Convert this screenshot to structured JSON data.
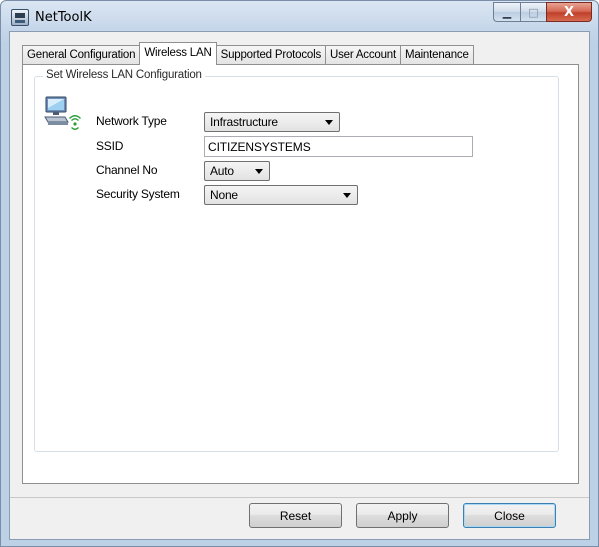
{
  "window": {
    "title": "NetToolK",
    "caption_buttons": {
      "minimize": "▁",
      "maximize": "□",
      "close": "X"
    }
  },
  "tabs": [
    {
      "label": "General Configuration",
      "active": false
    },
    {
      "label": "Wireless LAN",
      "active": true
    },
    {
      "label": "Supported Protocols",
      "active": false
    },
    {
      "label": "User Account",
      "active": false
    },
    {
      "label": "Maintenance",
      "active": false
    }
  ],
  "group": {
    "legend": "Set Wireless LAN Configuration",
    "icon": "wireless-network-icon"
  },
  "fields": {
    "network_type": {
      "label": "Network Type",
      "value": "Infrastructure"
    },
    "ssid": {
      "label": "SSID",
      "value": "CITIZENSYSTEMS"
    },
    "channel_no": {
      "label": "Channel No",
      "value": "Auto"
    },
    "security_system": {
      "label": "Security System",
      "value": "None"
    }
  },
  "buttons": {
    "reset": "Reset",
    "apply": "Apply",
    "close": "Close"
  },
  "colors": {
    "title_bar": "#c6d6ea",
    "dialog_bg": "#f0f0f0",
    "close_button": "#c0402a",
    "default_button_border": "#3c7fb1"
  }
}
